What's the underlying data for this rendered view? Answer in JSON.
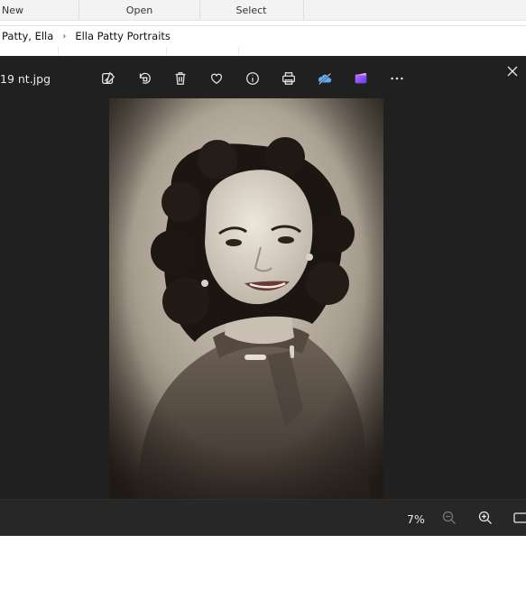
{
  "ribbon": {
    "new_label": "New",
    "open_label": "Open",
    "select_label": "Select"
  },
  "address": {
    "crumbs": [
      "Patty, Ella",
      "Ella Patty Portraits"
    ],
    "separator": "›"
  },
  "viewer": {
    "file_name": "19 nt.jpg",
    "toolbar_icons": [
      "edit-image-icon",
      "rotate-icon",
      "delete-icon",
      "favorite-icon",
      "info-icon",
      "print-icon",
      "onedrive-icon",
      "clipchamp-icon",
      "more-icon"
    ],
    "zoom_level": "7%"
  },
  "colors": {
    "viewer_bg": "#202020",
    "bottom_bar": "#272727",
    "onedrive": "#5aa9ff",
    "clipchamp": "#9b5cff"
  }
}
